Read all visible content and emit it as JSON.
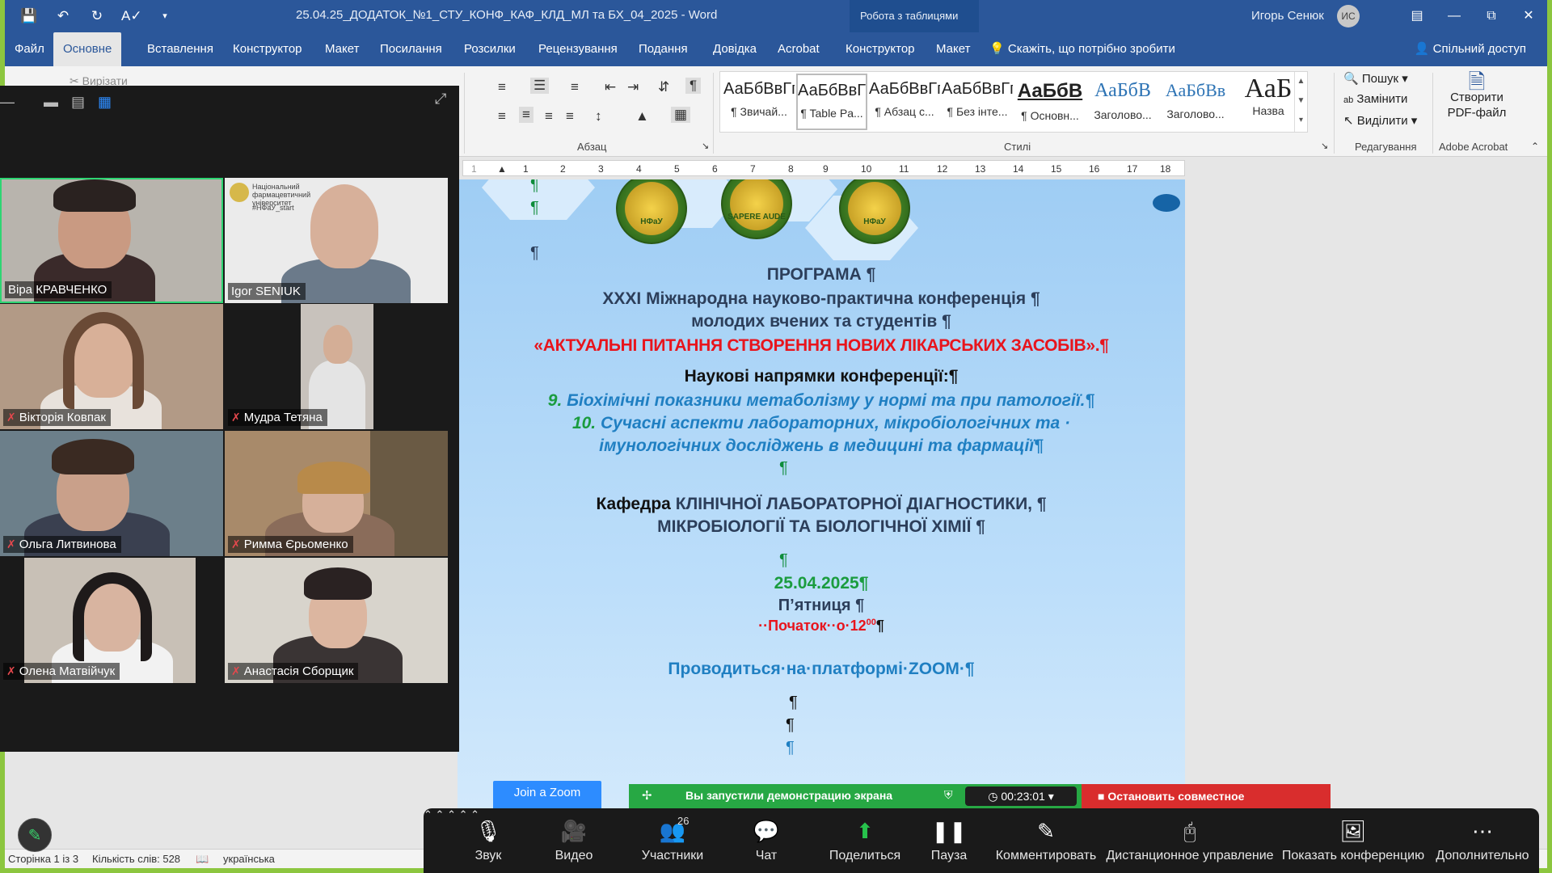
{
  "word": {
    "doc_title": "25.04.25_ДОДАТОК_№1_СТУ_КОНФ_КАФ_КЛД_МЛ та БХ_04_2025  -  Word",
    "context_title": "Робота з таблицями",
    "user_name": "Игорь Сенюк",
    "user_initials": "ИС",
    "tabs": [
      "Файл",
      "Основне",
      "Вставлення",
      "Конструктор",
      "Макет",
      "Посилання",
      "Розсилки",
      "Рецензування",
      "Подання",
      "Довідка",
      "Acrobat",
      "Конструктор",
      "Макет"
    ],
    "active_tab": "Основне",
    "tell_me": "Скажіть, що потрібно зробити",
    "share": "Спільний доступ",
    "ribbon": {
      "cut": "Вирізати",
      "paragraph_label": "Абзац",
      "styles_label": "Стилі",
      "editing_label": "Редагування",
      "acrobat_label": "Adobe Acrobat",
      "styles": [
        {
          "sample": "АаБбВвГг",
          "name": "¶ Звичай..."
        },
        {
          "sample": "АаБбВвГг",
          "name": "¶ Table Pa..."
        },
        {
          "sample": "АаБбВвГг",
          "name": "¶ Абзац с..."
        },
        {
          "sample": "АаБбВвГг",
          "name": "¶ Без інте..."
        },
        {
          "sample": "АаБбВ",
          "name": "¶ Основн..."
        },
        {
          "sample": "АаБбВ",
          "name": "Заголово..."
        },
        {
          "sample": "АаБбВв",
          "name": "Заголово..."
        },
        {
          "sample": "АаБ",
          "name": "Назва"
        }
      ],
      "search": "Пошук",
      "replace": "Замінити",
      "select": "Виділити",
      "create_pdf": "Створити PDF-файл"
    },
    "ruler_marks": [
      "1",
      "2",
      "1",
      "2",
      "3",
      "4",
      "5",
      "6",
      "7",
      "8",
      "9",
      "10",
      "11",
      "12",
      "13",
      "14",
      "15",
      "16",
      "17",
      "18"
    ],
    "status": {
      "page": "Сторінка 1 із 3",
      "words": "Кількість слів: 528",
      "lang": "українська"
    }
  },
  "document": {
    "seal_text_1": "НФаУ",
    "seal_text_2": "SAPERE AUDE",
    "seal_text_3": "НФаУ",
    "program": "ПРОГРАМА ¶",
    "conf_line1": "XXXI Міжнародна науково-практична конференція ¶",
    "conf_line2": "молодих вчених та студентів ¶",
    "conf_title": "«АКТУАЛЬНІ ПИТАННЯ СТВОРЕННЯ НОВИХ ЛІКАРСЬКИХ ЗАСОБІВ».¶",
    "directions": "Наукові напрямки конференції:¶",
    "dir9_num": "9.",
    "dir9": "Біохімічні показники метаболізму у нормі та при патології.¶",
    "dir10_num": "10.",
    "dir10a": "Сучасні аспекти лабораторних, мікробіологічних та ·",
    "dir10b": "імунологічних досліджень в медицині та фармації¶",
    "dept_prefix": "Кафедра",
    "dept1": "КЛІНІЧНОЇ ЛАБОРАТОРНОЇ ДІАГНОСТИКИ, ¶",
    "dept2": "МІКРОБІОЛОГІЇ ТА БІОЛОГІЧНОЇ ХІМІЇ ¶",
    "date": "25.04.2025¶",
    "weekday": "П’ятниця ¶",
    "start": "··Початок··о·12",
    "start_sup": "00",
    "start_end": "¶",
    "platform": "Проводиться·на·платформі·ZOOM·¶"
  },
  "zoom": {
    "participants": [
      {
        "name": "Віра КРАВЧЕНКО",
        "muted": false,
        "speaking": true
      },
      {
        "name": "Igor SENIUK",
        "muted": false,
        "speaking": false
      },
      {
        "name": "Вікторія Ковпак",
        "muted": true,
        "speaking": false
      },
      {
        "name": "Мудра Тетяна",
        "muted": true,
        "speaking": false
      },
      {
        "name": "Ольга Литвинова",
        "muted": true,
        "speaking": false
      },
      {
        "name": "Римма Єрьоменко",
        "muted": true,
        "speaking": false
      },
      {
        "name": "Олена Матвійчук",
        "muted": true,
        "speaking": false
      },
      {
        "name": "Анастасія Сборщик",
        "muted": true,
        "speaking": false
      }
    ],
    "igor_tile_text": "Національний фармацевтичний університет",
    "igor_tile_tag": "#НФаУ_start",
    "share_status": "Вы запустили демонстрацию экрана",
    "timer": "00:23:01",
    "stop_share": "Остановить совместное использование",
    "join_zoom": "Join a Zoom",
    "toolbar": {
      "mic": "Звук",
      "video": "Видео",
      "participants": "Участники",
      "participants_count": "26",
      "chat": "Чат",
      "share": "Поделиться",
      "pause": "Пауза",
      "annotate": "Комментировать",
      "remote": "Дистанционное управление",
      "show_conf": "Показать конференцию",
      "more": "Дополнительно"
    }
  },
  "colors": {
    "word_blue": "#2b579a",
    "doc_red": "#e8141c",
    "doc_green": "#1a9c3e",
    "doc_blue": "#1f7fc2",
    "doc_dark": "#2c3e5a",
    "zoom_green": "#27a844",
    "zoom_red": "#d92d2d"
  }
}
